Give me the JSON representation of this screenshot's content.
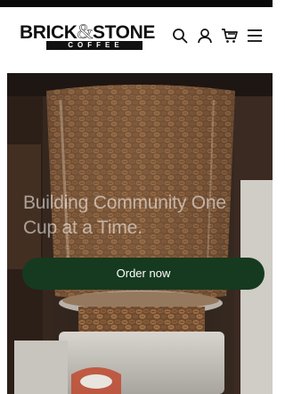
{
  "brand": {
    "wordmark_left": "BRICK",
    "wordmark_amp": "&",
    "wordmark_right": "STONE",
    "tagline": "COFFEE"
  },
  "header": {
    "icons": [
      "search-icon",
      "account-icon",
      "cart-icon",
      "menu-icon"
    ]
  },
  "hero": {
    "title": "Building Community One Cup at a Time.",
    "cta_label": "Order now"
  },
  "colors": {
    "cta_background": "#163a1f",
    "cta_text": "#ffffff",
    "topbar": "#0a0a0a"
  }
}
